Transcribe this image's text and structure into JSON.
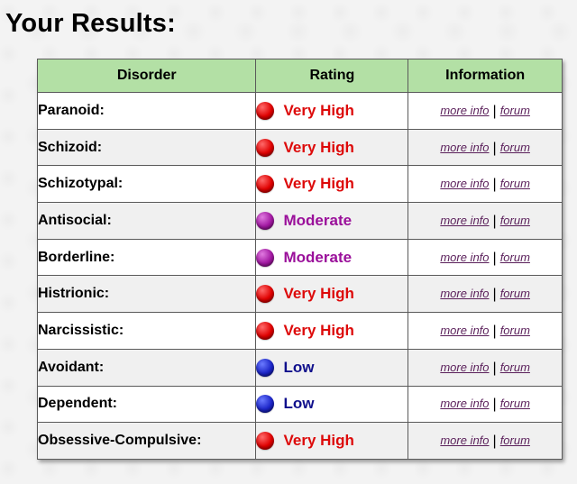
{
  "page": {
    "title": "Your Results:"
  },
  "table": {
    "headers": {
      "disorder": "Disorder",
      "rating": "Rating",
      "information": "Information"
    },
    "more_info_label": "more info",
    "forum_label": "forum",
    "separator": "|",
    "rows": [
      {
        "disorder": "Paranoid:",
        "rating": "Very High",
        "icon": "red-dot-icon"
      },
      {
        "disorder": "Schizoid:",
        "rating": "Very High",
        "icon": "red-dot-icon"
      },
      {
        "disorder": "Schizotypal:",
        "rating": "Very High",
        "icon": "red-dot-icon"
      },
      {
        "disorder": "Antisocial:",
        "rating": "Moderate",
        "icon": "purple-dot-icon"
      },
      {
        "disorder": "Borderline:",
        "rating": "Moderate",
        "icon": "purple-dot-icon"
      },
      {
        "disorder": "Histrionic:",
        "rating": "Very High",
        "icon": "red-dot-icon"
      },
      {
        "disorder": "Narcissistic:",
        "rating": "Very High",
        "icon": "red-dot-icon"
      },
      {
        "disorder": "Avoidant:",
        "rating": "Low",
        "icon": "blue-dot-icon"
      },
      {
        "disorder": "Dependent:",
        "rating": "Low",
        "icon": "blue-dot-icon"
      },
      {
        "disorder": "Obsessive-Compulsive:",
        "rating": "Very High",
        "icon": "red-dot-icon"
      }
    ]
  },
  "rating_colors": {
    "Very High": "#dd0a0a",
    "Moderate": "#9a0f9a",
    "Low": "#10108c"
  },
  "dot_gradients": {
    "Very High": [
      "#ff6a6a",
      "#e00000",
      "#8a0000"
    ],
    "Moderate": [
      "#e07ae0",
      "#a218a2",
      "#5c065c"
    ],
    "Low": [
      "#6a7aff",
      "#1c25c8",
      "#05096a"
    ]
  },
  "colors": {
    "header_bg": "#b3e0a5",
    "link": "#5a1f5a"
  }
}
